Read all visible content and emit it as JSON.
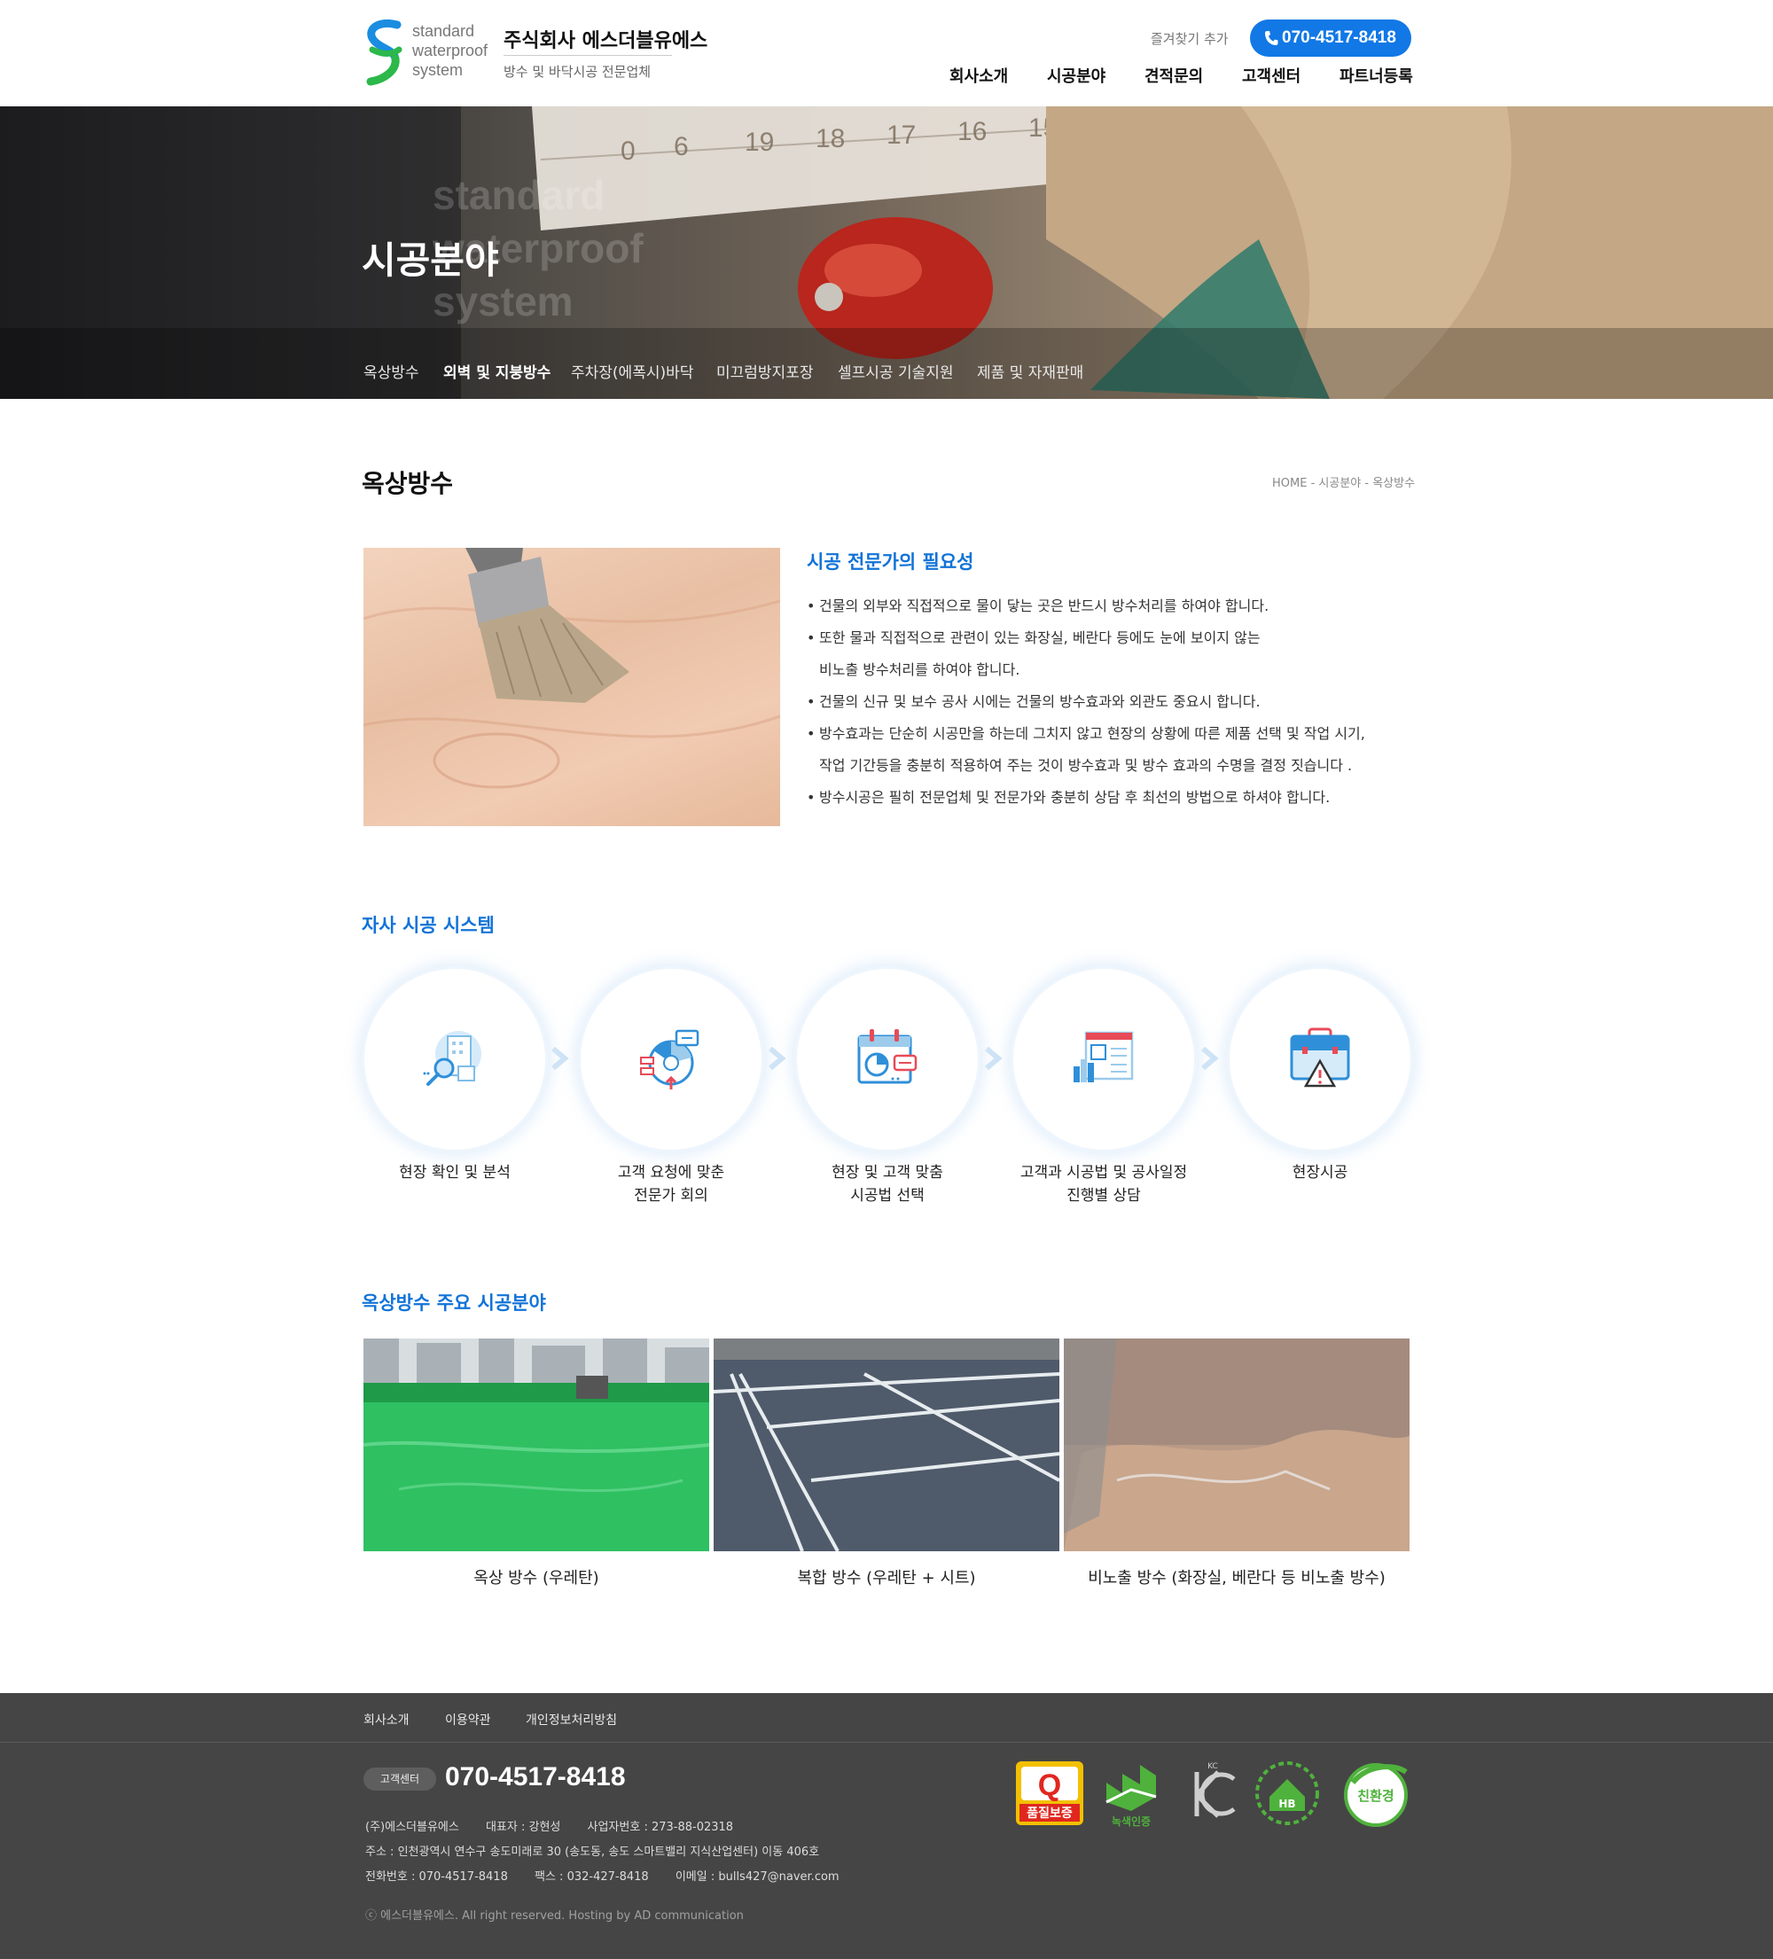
{
  "header": {
    "logo_words": [
      "standard",
      "waterproof",
      "system"
    ],
    "company_name": "주식회사 에스더블유에스",
    "company_sub": "방수 및 바닥시공 전문업체",
    "bookmark": "즐겨찾기 추가",
    "phone": "070-4517-8418",
    "gnb": [
      "회사소개",
      "시공분야",
      "견적문의",
      "고객센터",
      "파트너등록"
    ]
  },
  "hero": {
    "title": "시공분야",
    "watermark": [
      "standard",
      "waterproof",
      "system"
    ],
    "subnav": [
      "옥상방수",
      "외벽 및 지붕방수",
      "주차장(에폭시)바닥",
      "미끄럼방지포장",
      "셀프시공 기술지원",
      "제품 및 자재판매"
    ],
    "active_index": 1
  },
  "page": {
    "title": "옥상방수",
    "breadcrumb": "HOME - 시공분야 - 옥상방수"
  },
  "intro": {
    "heading": "시공 전문가의 필요성",
    "lines": [
      {
        "bullet": true,
        "text": "건물의 외부와 직접적으로 물이 닿는 곳은 반드시 방수처리를 하여야 합니다."
      },
      {
        "bullet": true,
        "text": "또한 물과 직접적으로 관련이 있는 화장실, 베란다 등에도 눈에 보이지 않는"
      },
      {
        "bullet": false,
        "text": "비노출 방수처리를 하여야 합니다."
      },
      {
        "bullet": true,
        "text": "건물의 신규 및 보수 공사 시에는 건물의 방수효과와 외관도 중요시 합니다."
      },
      {
        "bullet": true,
        "text": "방수효과는 단순히 시공만을 하는데 그치지 않고 현장의 상황에 따른 제품 선택 및 작업 시기,"
      },
      {
        "bullet": false,
        "text": "작업 기간등을 충분히 적용하여 주는 것이 방수효과 및 방수 효과의 수명을 결정 짓습니다 ."
      },
      {
        "bullet": true,
        "text": "방수시공은 필히 전문업체 및 전문가와 충분히 상담 후 최선의 방법으로 하셔야 합니다."
      }
    ]
  },
  "process": {
    "title": "자사 시공 시스템",
    "steps": [
      {
        "icon": "search-building-icon",
        "label": [
          "현장 확인 및 분석"
        ]
      },
      {
        "icon": "meeting-chart-icon",
        "label": [
          "고객 요청에 맞춘",
          "전문가 회의"
        ]
      },
      {
        "icon": "calendar-chat-icon",
        "label": [
          "현장 및 고객 맞춤",
          "시공법 선택"
        ]
      },
      {
        "icon": "schedule-report-icon",
        "label": [
          "고객과 시공법 및 공사일정",
          "진행별 상담"
        ]
      },
      {
        "icon": "toolbox-warning-icon",
        "label": [
          "현장시공"
        ]
      }
    ]
  },
  "gallery": {
    "title": "옥상방수 주요 시공분야",
    "items": [
      {
        "caption": "옥상 방수 (우레탄)"
      },
      {
        "caption": "복합 방수 (우레탄 + 시트)"
      },
      {
        "caption": "비노출 방수 (화장실, 베란다 등 비노출 방수)"
      }
    ]
  },
  "footer": {
    "nav": [
      "회사소개",
      "이용약관",
      "개인정보처리방침"
    ],
    "cs_label": "고객센터",
    "cs_phone": "070-4517-8418",
    "info_row1": [
      "(주)에스더블유에스",
      "대표자 : 강현성",
      "사업자번호 : 273-88-02318"
    ],
    "info_row2": [
      "주소 : 인천광역시 연수구 송도미래로 30 (송도동, 송도 스마트밸리 지식산업센터) 이동 406호"
    ],
    "info_row3": [
      "전화번호 : 070-4517-8418",
      "팩스 : 032-427-8418",
      "이메일 : bulls427@naver.com"
    ],
    "copyright": "ⓒ 에스더블유에스. All right reserved. Hosting by AD communication",
    "certs": [
      {
        "name": "quality-mark",
        "label": "품질보증"
      },
      {
        "name": "green-cert",
        "label": "녹색인증"
      },
      {
        "name": "kc-mark",
        "label": "KC"
      },
      {
        "name": "healthy-building",
        "label": "HB"
      },
      {
        "name": "eco-mark",
        "label": "친환경"
      }
    ]
  }
}
